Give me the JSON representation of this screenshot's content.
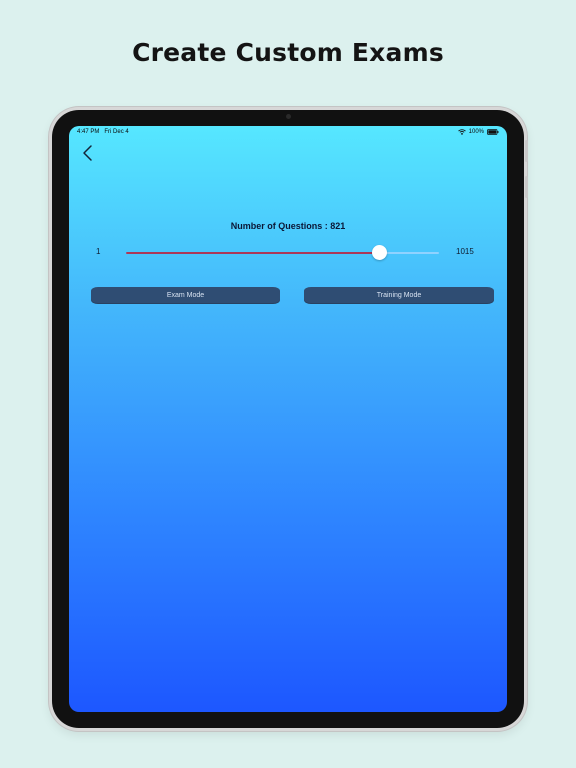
{
  "headline": "Create Custom Exams",
  "status_bar": {
    "time": "4:47 PM",
    "date": "Fri Dec 4",
    "battery": "100%"
  },
  "screen": {
    "title": "Number of Questions : 821",
    "slider": {
      "min_label": "1",
      "max_label": "1015",
      "value_fraction": 0.81
    },
    "buttons": {
      "exam_mode": "Exam Mode",
      "training_mode": "Training Mode"
    }
  },
  "colors": {
    "background": "#dcf1ee",
    "gradient_top": "#56e7ff",
    "gradient_bottom": "#1d57ff",
    "slider_fill": "#ab3858",
    "button_fill": "#2f4d73"
  },
  "icons": {
    "back": "chevron-left-icon",
    "wifi": "wifi-icon",
    "battery": "battery-icon"
  }
}
